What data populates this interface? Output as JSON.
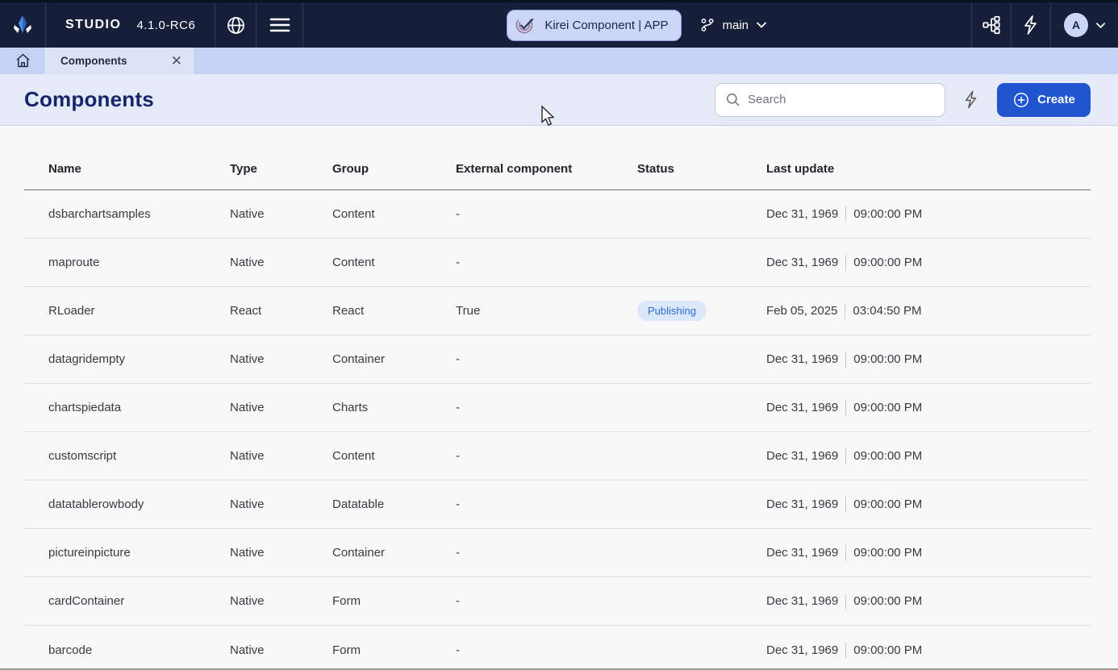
{
  "topbar": {
    "brand": {
      "name": "STUDIO",
      "version": "4.1.0-RC6"
    },
    "app_pill": {
      "label": "Kirei Component | APP"
    },
    "branch": {
      "label": "main"
    },
    "avatar": {
      "initial": "A"
    }
  },
  "tabbar": {
    "active_tab": "Components"
  },
  "header": {
    "title": "Components",
    "search_placeholder": "Search",
    "create_label": "Create"
  },
  "table": {
    "columns": [
      "Name",
      "Type",
      "Group",
      "External component",
      "Status",
      "Last update"
    ],
    "rows": [
      {
        "name": "dsbarchartsamples",
        "type": "Native",
        "group": "Content",
        "external": "-",
        "status": "",
        "date": "Dec 31, 1969",
        "time": "09:00:00 PM"
      },
      {
        "name": "maproute",
        "type": "Native",
        "group": "Content",
        "external": "-",
        "status": "",
        "date": "Dec 31, 1969",
        "time": "09:00:00 PM"
      },
      {
        "name": "RLoader",
        "type": "React",
        "group": "React",
        "external": "True",
        "status": "Publishing",
        "date": "Feb 05, 2025",
        "time": "03:04:50 PM"
      },
      {
        "name": "datagridempty",
        "type": "Native",
        "group": "Container",
        "external": "-",
        "status": "",
        "date": "Dec 31, 1969",
        "time": "09:00:00 PM"
      },
      {
        "name": "chartspiedata",
        "type": "Native",
        "group": "Charts",
        "external": "-",
        "status": "",
        "date": "Dec 31, 1969",
        "time": "09:00:00 PM"
      },
      {
        "name": "customscript",
        "type": "Native",
        "group": "Content",
        "external": "-",
        "status": "",
        "date": "Dec 31, 1969",
        "time": "09:00:00 PM"
      },
      {
        "name": "datatablerowbody",
        "type": "Native",
        "group": "Datatable",
        "external": "-",
        "status": "",
        "date": "Dec 31, 1969",
        "time": "09:00:00 PM"
      },
      {
        "name": "pictureinpicture",
        "type": "Native",
        "group": "Container",
        "external": "-",
        "status": "",
        "date": "Dec 31, 1969",
        "time": "09:00:00 PM"
      },
      {
        "name": "cardContainer",
        "type": "Native",
        "group": "Form",
        "external": "-",
        "status": "",
        "date": "Dec 31, 1969",
        "time": "09:00:00 PM"
      },
      {
        "name": "barcode",
        "type": "Native",
        "group": "Form",
        "external": "-",
        "status": "",
        "date": "Dec 31, 1969",
        "time": "09:00:00 PM"
      }
    ]
  },
  "colors": {
    "topbar_bg": "#161f39",
    "tabbar_bg": "#c6d2f4",
    "active_tab_bg": "#dce3f9",
    "page_header_bg": "#e5eaf9",
    "title_text": "#17256b",
    "accent_blue": "#2155d0",
    "pill_bg": "#ccd7f7",
    "badge_bg": "#dbe7fb",
    "badge_text": "#2f6cd0"
  }
}
